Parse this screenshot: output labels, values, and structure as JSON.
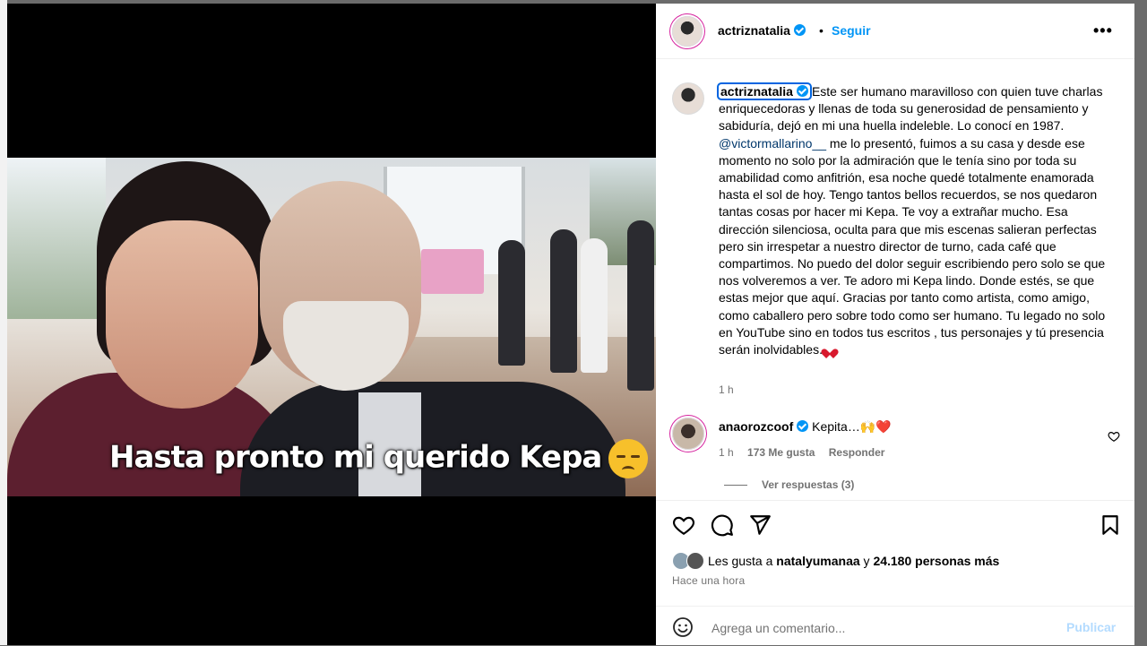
{
  "post": {
    "overlay_text": "Hasta pronto mi querido Kepa",
    "overlay_emoji": "disappointed-face"
  },
  "header": {
    "username": "actriznatalia",
    "separator": "•",
    "follow_label": "Seguir",
    "more_label": "•••"
  },
  "caption": {
    "username": "actriznatalia",
    "text_part1": "Este ser humano maravilloso con quien tuve charlas enriquecedoras y llenas de toda su generosidad de pensamiento y sabiduría, dejó en mi una huella indeleble. Lo conocí en 1987. ",
    "mention": "@victormallarino__",
    "text_part2": " me lo presentó, fuimos a su casa y desde ese momento no solo por la admiración que le tenía sino por toda su amabilidad como anfitrión, esa noche quedé totalmente enamorada hasta el sol de hoy. Tengo tantos bellos recuerdos, se nos quedaron tantas cosas por hacer mi Kepa. Te voy a extrañar mucho. Esa dirección silenciosa, oculta para que mis escenas salieran perfectas pero sin irrespetar a nuestro director de turno, cada café que compartimos. No puedo del dolor seguir escribiendo pero solo se que nos volveremos a ver. Te adoro mi Kepa lindo. Donde estés, se que estas mejor que aquí. Gracias por tanto como artista, como amigo, como caballero pero sobre todo como ser humano. Tu legado no solo en YouTube sino en todos tus escritos , tus personajes y tú presencia serán inolvidables.",
    "time": "1 h"
  },
  "comment": {
    "username": "anaorozcoof",
    "text": "Kepita…🙌❤️",
    "time": "1 h",
    "likes": "173 Me gusta",
    "reply_label": "Responder",
    "view_replies": "Ver respuestas (3)"
  },
  "likes": {
    "prefix": "Les gusta a ",
    "user": "natalyumanaa",
    "middle": " y ",
    "count": "24.180 personas más"
  },
  "time_ago": "Hace una hora",
  "add_comment": {
    "placeholder": "Agrega un comentario...",
    "publish_label": "Publicar"
  },
  "colors": {
    "accent": "#0095f6",
    "link": "#00376b",
    "muted": "#737373",
    "publish_disabled": "#b3dbff",
    "heart": "#d8192d"
  }
}
